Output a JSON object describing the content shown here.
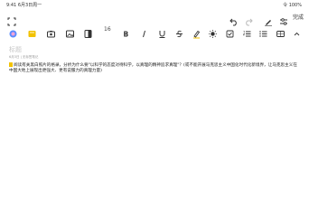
{
  "status_bar": {
    "time": "9:41 6月3日周一",
    "indicators": "令 100%"
  },
  "top_bar": {
    "done_label": "完成"
  },
  "toolbar": {
    "font_size_label": "16"
  },
  "document": {
    "title_placeholder": "标题",
    "meta": "6月3日 | 无标签笔记",
    "body": "阅读有关黑白照片的格录，分析为什么要\"以科学的态度对待科学，以真理的精神追求真理\"？(或不能开展马克思主义中国化时代化新境界，让马克思主义在中国大地上展现出更强大、更有说服力的真理力量)"
  },
  "icons": {
    "top_left": [
      "expand-icon"
    ],
    "top_right": [
      "undo-icon",
      "redo-icon",
      "pen-icon",
      "settings-icon"
    ],
    "toolbar": [
      "ai-icon",
      "sticker-icon",
      "camera-icon",
      "image-icon",
      "attachment-icon",
      "bold-icon",
      "italic-icon",
      "underline-icon",
      "strikethrough-icon",
      "highlight-icon",
      "text-color-icon",
      "checkbox-icon",
      "ordered-list-icon",
      "bullet-list-icon",
      "table-icon",
      "chevron-up-icon"
    ]
  }
}
